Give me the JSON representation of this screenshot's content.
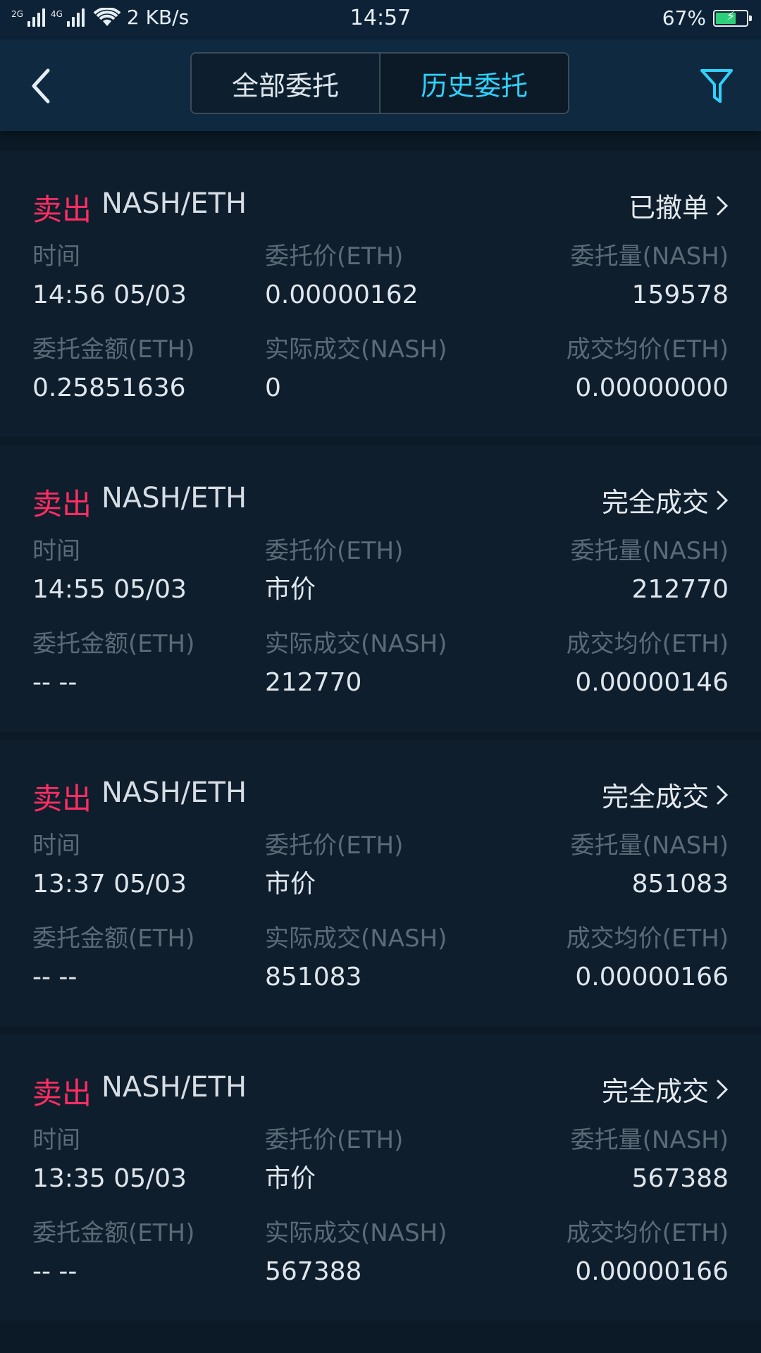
{
  "status_bar": {
    "sim1_tag": "2G",
    "sim2_tag": "4G",
    "speed": "2 KB/s",
    "time": "14:57",
    "battery": "67%",
    "battery_level": 0.67
  },
  "header": {
    "tabs": [
      {
        "label": "全部委托",
        "active": false
      },
      {
        "label": "历史委托",
        "active": true
      }
    ],
    "icons": {
      "back": "chevron-left-icon",
      "filter": "filter-icon"
    },
    "accent": "#2fd2ff"
  },
  "labels": {
    "time": "时间",
    "price": "委托价(ETH)",
    "amount": "委托量(NASH)",
    "total": "委托金额(ETH)",
    "filled": "实际成交(NASH)",
    "avg": "成交均价(ETH)"
  },
  "orders": [
    {
      "side": "卖出",
      "pair": "NASH/ETH",
      "status": "已撤单",
      "time": "14:56 05/03",
      "price": "0.00000162",
      "amount": "159578",
      "total": "0.25851636",
      "filled": "0",
      "avg": "0.00000000"
    },
    {
      "side": "卖出",
      "pair": "NASH/ETH",
      "status": "完全成交",
      "time": "14:55 05/03",
      "price": "市价",
      "amount": "212770",
      "total": "-- --",
      "filled": "212770",
      "avg": "0.00000146"
    },
    {
      "side": "卖出",
      "pair": "NASH/ETH",
      "status": "完全成交",
      "time": "13:37 05/03",
      "price": "市价",
      "amount": "851083",
      "total": "-- --",
      "filled": "851083",
      "avg": "0.00000166"
    },
    {
      "side": "卖出",
      "pair": "NASH/ETH",
      "status": "完全成交",
      "time": "13:35 05/03",
      "price": "市价",
      "amount": "567388",
      "total": "-- --",
      "filled": "567388",
      "avg": "0.00000166"
    }
  ],
  "colors": {
    "sell": "#ff2d63",
    "label": "#5a6b78",
    "value": "#dfe6ed"
  }
}
